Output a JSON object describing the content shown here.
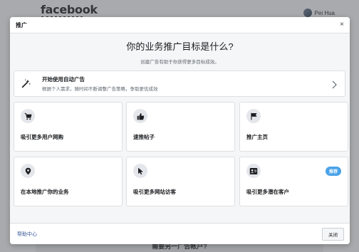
{
  "background": {
    "logo": "facebook",
    "user_name": "Pei Hua",
    "bottom_text": "需要另一广告帐户?"
  },
  "modal": {
    "title": "推广",
    "close_glyph": "×",
    "heading": "你的业务推广目标是什么?",
    "subheading": "创建广告有助于你获得更多目标成效。",
    "auto_ads": {
      "title": "开始使用自动广告",
      "description": "根据个人需求，随时间不断调整广告策略，争取更优成效",
      "icon": "magic-wand-icon"
    },
    "options": [
      {
        "label": "吸引更多用户网购",
        "icon": "shopping-cart-icon"
      },
      {
        "label": "速推帖子",
        "icon": "thumbs-up-icon"
      },
      {
        "label": "推广主页",
        "icon": "flag-icon"
      },
      {
        "label": "在本地推广你的业务",
        "icon": "location-pin-icon"
      },
      {
        "label": "吸引更多网站访客",
        "icon": "cursor-icon"
      },
      {
        "label": "吸引更多潜在客户",
        "icon": "contact-card-icon",
        "badge": "推荐"
      }
    ],
    "footer": {
      "help_link": "帮助中心",
      "close_button": "关闭"
    }
  },
  "colors": {
    "link": "#385898",
    "badge": "#4aa3e8",
    "icon_circle": "#e4e6eb"
  }
}
